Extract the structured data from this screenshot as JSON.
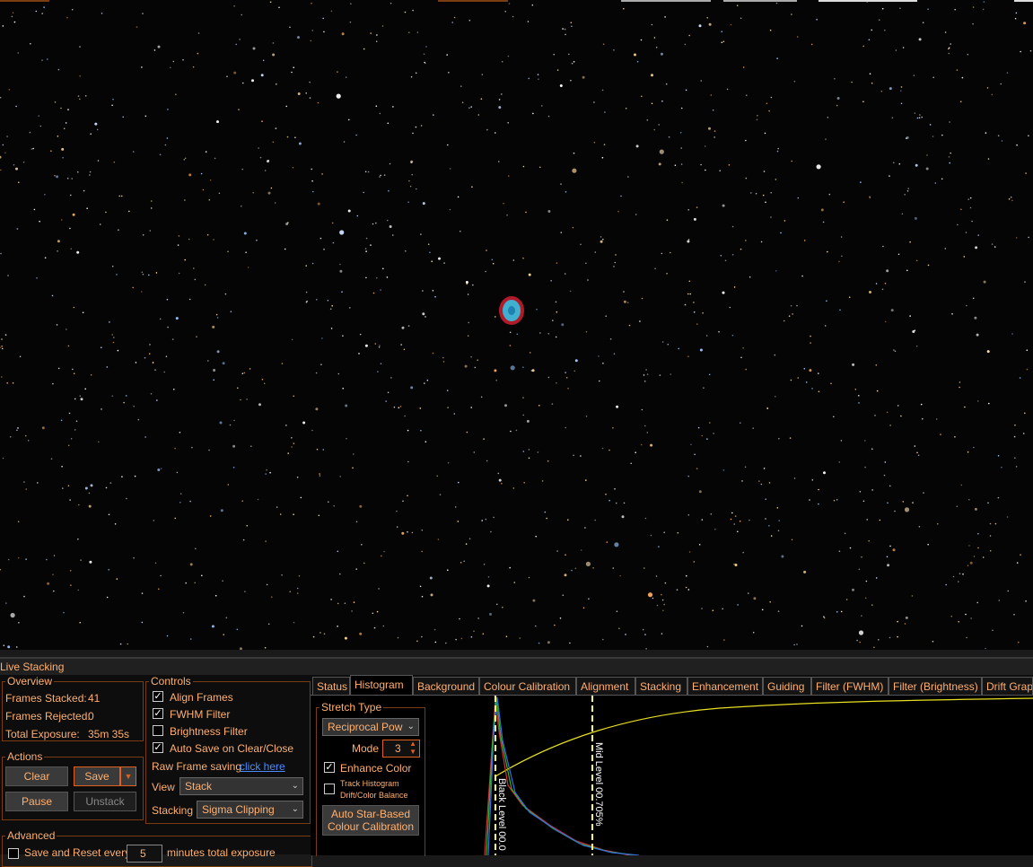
{
  "viewer": {
    "icon": "starfield-image"
  },
  "live_stacking": {
    "title": "Live Stacking"
  },
  "overview": {
    "legend": "Overview",
    "frames_stacked_label": "Frames Stacked:",
    "frames_stacked": "41",
    "frames_rejected_label": "Frames Rejected:",
    "frames_rejected": "0",
    "total_exposure_label": "Total Exposure:",
    "total_exposure": "35m 35s"
  },
  "actions": {
    "legend": "Actions",
    "clear": "Clear",
    "save": "Save",
    "pause": "Pause",
    "unstack": "Unstack"
  },
  "advanced": {
    "legend": "Advanced",
    "save_reset_label": "Save and Reset every",
    "save_reset_value": "5",
    "minutes_label": "minutes total exposure"
  },
  "controls": {
    "legend": "Controls",
    "align_frames": "Align Frames",
    "align_frames_checked": true,
    "fwhm_filter": "FWHM Filter",
    "fwhm_filter_checked": true,
    "brightness_filter": "Brightness Filter",
    "brightness_filter_checked": false,
    "auto_save": "Auto Save on Clear/Close",
    "auto_save_checked": true,
    "raw_frame_label": "Raw Frame saving",
    "raw_frame_link": "click here",
    "view_label": "View",
    "view_value": "Stack",
    "stacking_label": "Stacking",
    "stacking_value": "Sigma Clipping"
  },
  "tabs": [
    "Status",
    "Histogram",
    "Background",
    "Colour Calibration",
    "Alignment",
    "Stacking",
    "Enhancement",
    "Guiding",
    "Filter (FWHM)",
    "Filter (Brightness)",
    "Drift Grap"
  ],
  "active_tab": "Histogram",
  "histogram": {
    "stretch_legend": "Stretch Type",
    "stretch_value": "Reciprocal Pow",
    "mode_label": "Mode",
    "mode_value": "3",
    "enhance_color": "Enhance Color",
    "enhance_color_checked": true,
    "track_histogram_line1": "Track Histogram",
    "track_histogram_line2": "Drift/Color Balance",
    "track_histogram_checked": false,
    "auto_calib_line1": "Auto Star-Based",
    "auto_calib_line2": "Colour Calibration",
    "black_level": "Black Level 00.0",
    "mid_level": "Mid Level 00.705%"
  },
  "colors": {
    "accent": "#ffb070",
    "border": "#7a3d12",
    "link": "#4a8cff",
    "curve": "#e8e020",
    "marker": "#ffff60"
  }
}
